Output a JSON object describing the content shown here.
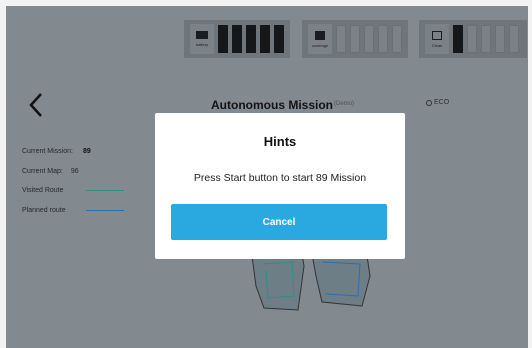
{
  "status_bar": {
    "battery": {
      "label": "battery",
      "icon": "battery-icon",
      "level_bars": 5,
      "total_bars": 5
    },
    "coverage": {
      "label": "coverage",
      "icon": "coverage-icon",
      "level_bars": 0,
      "total_bars": 5
    },
    "clean": {
      "label": "Clean",
      "icon": "clean-icon",
      "level_bars": 1,
      "total_bars": 5
    }
  },
  "header": {
    "title": "Autonomous Mission",
    "subtitle": "(Demo)",
    "right_label": "ECO"
  },
  "info": {
    "current_mission_label": "Current Mission:",
    "current_mission_value": "89",
    "current_map_label": "Current Map:",
    "current_map_value": "96",
    "visited_route_label": "Visited Route",
    "planned_route_label": "Planned route"
  },
  "colors": {
    "overlay": "#82898f",
    "accent": "#2aa8e0",
    "visited_route": "#2f8f86",
    "planned_route": "#2a6fb0"
  },
  "modal": {
    "title": "Hints",
    "message": "Press Start button to start 89 Mission",
    "cancel_label": "Cancel"
  }
}
